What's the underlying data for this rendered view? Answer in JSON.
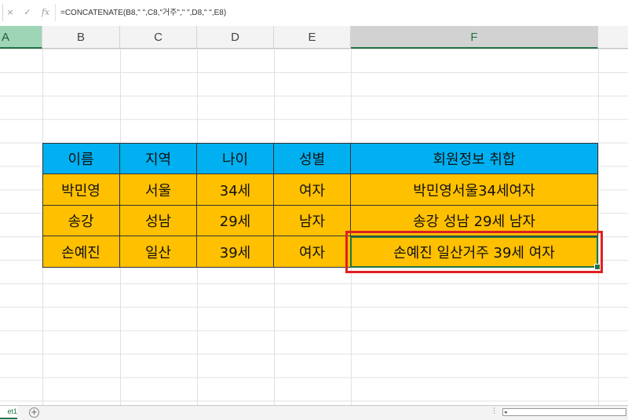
{
  "formula_bar": {
    "cancel_icon": "×",
    "enter_icon": "✓",
    "function_icon": "fx",
    "formula": "=CONCATENATE(B8,\" \",C8,\"거주\",\" \",D8,\" \",E8)"
  },
  "columns": [
    "A",
    "B",
    "C",
    "D",
    "E",
    "F"
  ],
  "table": {
    "headers": [
      "이름",
      "지역",
      "나이",
      "성별",
      "회원정보 취합"
    ],
    "rows": [
      [
        "박민영",
        "서울",
        "34세",
        "여자",
        "박민영서울34세여자"
      ],
      [
        "송강",
        "성남",
        "29세",
        "남자",
        "송강 성남 29세 남자"
      ],
      [
        "손예진",
        "일산",
        "39세",
        "여자",
        "손예진 일산거주 39세 여자"
      ]
    ]
  },
  "colors": {
    "header_fill": "#00b0f0",
    "body_fill": "#ffc000",
    "highlight": "#e02020",
    "excel_green": "#217346"
  },
  "bottom_bar": {
    "sheet_tab": "et1",
    "add_sheet": "+",
    "scroll_left_arrow": "◂"
  }
}
